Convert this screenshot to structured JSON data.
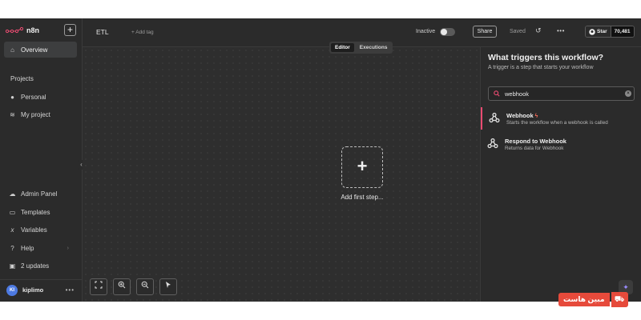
{
  "brand": {
    "name": "n8n"
  },
  "sidebar": {
    "add_label": "+",
    "overview": "Overview",
    "projects_title": "Projects",
    "projects": [
      "Personal",
      "My project"
    ],
    "bottom_items": [
      "Admin Panel",
      "Templates",
      "Variables",
      "Help",
      "2 updates"
    ],
    "user": {
      "initials": "KI",
      "name": "kiplimo"
    },
    "collapse_label": "‹"
  },
  "header": {
    "workflow_name": "ETL",
    "add_tag": "+ Add tag",
    "status_label": "Inactive",
    "share_label": "Share",
    "saved_label": "Saved",
    "github": {
      "star_label": "Star",
      "count": "70,481"
    }
  },
  "canvas": {
    "tabs": [
      "Editor",
      "Executions"
    ],
    "active_tab": "Editor",
    "add_step_symbol": "+",
    "add_step_label": "Add first step..."
  },
  "panel": {
    "title": "What triggers this workflow?",
    "subtitle": "A trigger is a step that starts your workflow",
    "search_value": "webhook",
    "results": [
      {
        "title": "Webhook",
        "description": "Starts the workflow when a webhook is called",
        "icon": "webhook-icon",
        "selected": true
      },
      {
        "title": "Respond to Webhook",
        "description": "Returns data for Webhook",
        "icon": "webhook-icon",
        "selected": false
      }
    ]
  },
  "watermark": {
    "text": "مبین هاست"
  },
  "colors": {
    "accent": "#ea4b71",
    "canvas": "#2e2e2e",
    "panel": "#2b2b2b"
  }
}
